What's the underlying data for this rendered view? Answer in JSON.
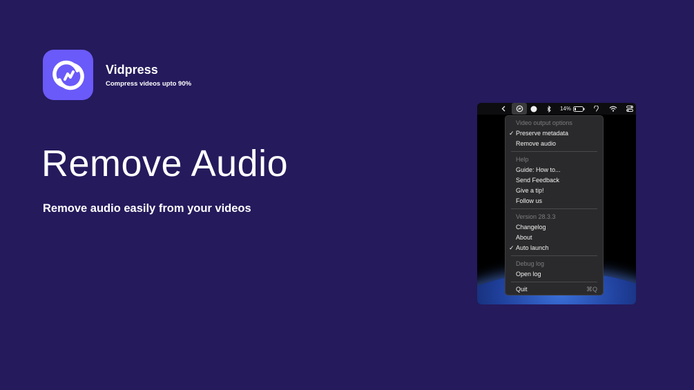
{
  "app": {
    "name": "Vidpress",
    "tagline": "Compress videos upto 90%",
    "brand_color": "#6a5af9",
    "background_color": "#251a5c"
  },
  "hero": {
    "title": "Remove Audio",
    "subtitle": "Remove audio easily from your videos"
  },
  "menubar": {
    "battery_percent": "14%",
    "icons": [
      "chevron-left-icon",
      "vidpress-app-icon",
      "white-dot-icon",
      "bluetooth-icon",
      "battery-icon",
      "hearing-icon",
      "wifi-icon",
      "control-center-icon"
    ]
  },
  "menu": {
    "video_section_header": "Video output options",
    "preserve_metadata": "Preserve metadata",
    "remove_audio": "Remove audio",
    "help_header": "Help",
    "guide": "Guide: How to...",
    "feedback": "Send Feedback",
    "tip": "Give a tip!",
    "follow": "Follow us",
    "version": "Version 28.3.3",
    "changelog": "Changelog",
    "about": "About",
    "auto_launch": "Auto launch",
    "debug_header": "Debug log",
    "open_log": "Open log",
    "quit": "Quit",
    "quit_shortcut": "⌘Q",
    "checkmark": "✓"
  }
}
